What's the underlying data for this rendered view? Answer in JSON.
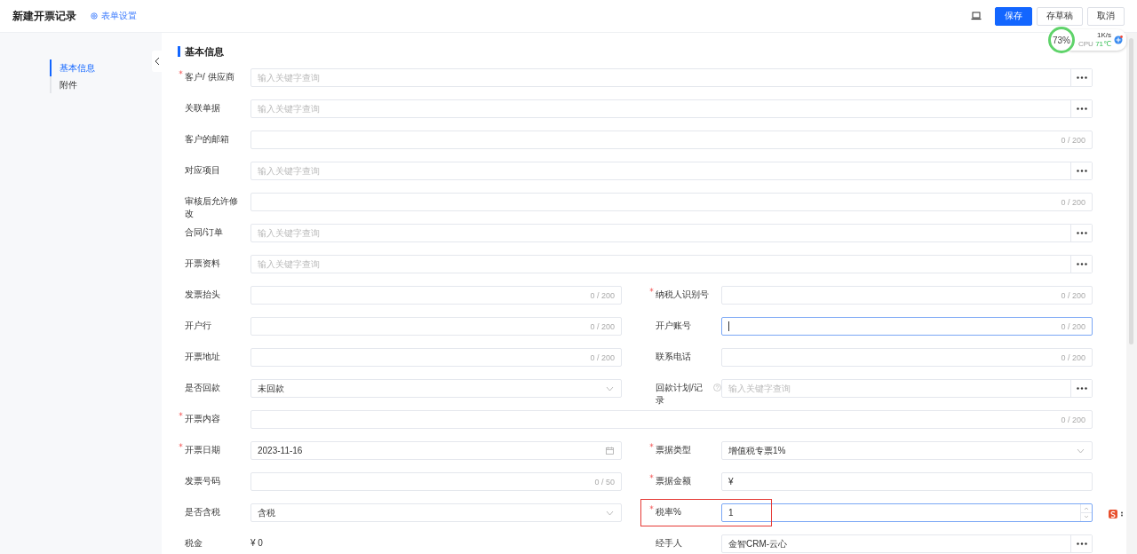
{
  "header": {
    "title": "新建开票记录",
    "settings_link": "表单设置",
    "buttons": [
      {
        "label": "保存",
        "kind": "primary"
      },
      {
        "label": "存草稿",
        "kind": "default"
      },
      {
        "label": "取消",
        "kind": "default"
      }
    ]
  },
  "system_monitor": {
    "percent": "73%",
    "speed": "1K/s",
    "cpu_label": "CPU",
    "temperature": "71℃"
  },
  "sidebar": {
    "items": [
      {
        "label": "基本信息",
        "selected": true
      },
      {
        "label": "附件",
        "selected": false
      }
    ]
  },
  "section": {
    "title": "基本信息",
    "rows": [
      [
        {
          "label": "客户/ 供应商",
          "required": true,
          "kind": "lookup",
          "placeholder": "输入关键字查询"
        }
      ],
      [
        {
          "label": "关联单据",
          "required": false,
          "kind": "lookup",
          "placeholder": "输入关键字查询"
        }
      ],
      [
        {
          "label": "客户的邮箱",
          "required": false,
          "kind": "text",
          "counter": "0 / 200"
        }
      ],
      [
        {
          "label": "对应项目",
          "required": false,
          "kind": "lookup",
          "placeholder": "输入关键字查询"
        }
      ],
      [
        {
          "label": "审核后允许修改",
          "required": false,
          "kind": "text",
          "counter": "0 / 200"
        }
      ],
      [
        {
          "label": "合同/订单",
          "required": false,
          "kind": "lookup",
          "placeholder": "输入关键字查询"
        }
      ],
      [
        {
          "label": "开票资料",
          "required": false,
          "kind": "lookup",
          "placeholder": "输入关键字查询"
        }
      ],
      [
        {
          "label": "发票抬头",
          "required": false,
          "kind": "text",
          "counter": "0 / 200"
        },
        {
          "label": "纳税人识别号",
          "required": true,
          "kind": "text",
          "counter": "0 / 200"
        }
      ],
      [
        {
          "label": "开户行",
          "required": false,
          "kind": "text",
          "counter": "0 / 200"
        },
        {
          "label": "开户账号",
          "required": false,
          "kind": "text",
          "counter": "0 / 200",
          "focused": true
        }
      ],
      [
        {
          "label": "开票地址",
          "required": false,
          "kind": "text",
          "counter": "0 / 200"
        },
        {
          "label": "联系电话",
          "required": false,
          "kind": "text",
          "counter": "0 / 200"
        }
      ],
      [
        {
          "label": "是否回款",
          "required": false,
          "kind": "select",
          "value": "未回款"
        },
        {
          "label": "回款计划/记录",
          "required": false,
          "kind": "lookup",
          "placeholder": "输入关键字查询",
          "help": true
        }
      ],
      [
        {
          "label": "开票内容",
          "required": true,
          "kind": "text",
          "counter": "0 / 200"
        }
      ],
      [
        {
          "label": "开票日期",
          "required": true,
          "kind": "date",
          "value": "2023-11-16"
        },
        {
          "label": "票据类型",
          "required": true,
          "kind": "select",
          "value": "增值税专票1%"
        }
      ],
      [
        {
          "label": "发票号码",
          "required": false,
          "kind": "text",
          "counter": "0 / 50"
        },
        {
          "label": "票据金额",
          "required": true,
          "kind": "text",
          "value": "¥"
        }
      ],
      [
        {
          "label": "是否含税",
          "required": false,
          "kind": "select",
          "value": "含税"
        },
        {
          "label": "税率%",
          "required": true,
          "kind": "number",
          "value": "1",
          "highlighted": true
        }
      ],
      [
        {
          "label": "税金",
          "required": false,
          "kind": "static",
          "value": "¥ 0"
        },
        {
          "label": "经手人",
          "required": false,
          "kind": "lookup",
          "value": "金智CRM-云心"
        }
      ]
    ]
  }
}
